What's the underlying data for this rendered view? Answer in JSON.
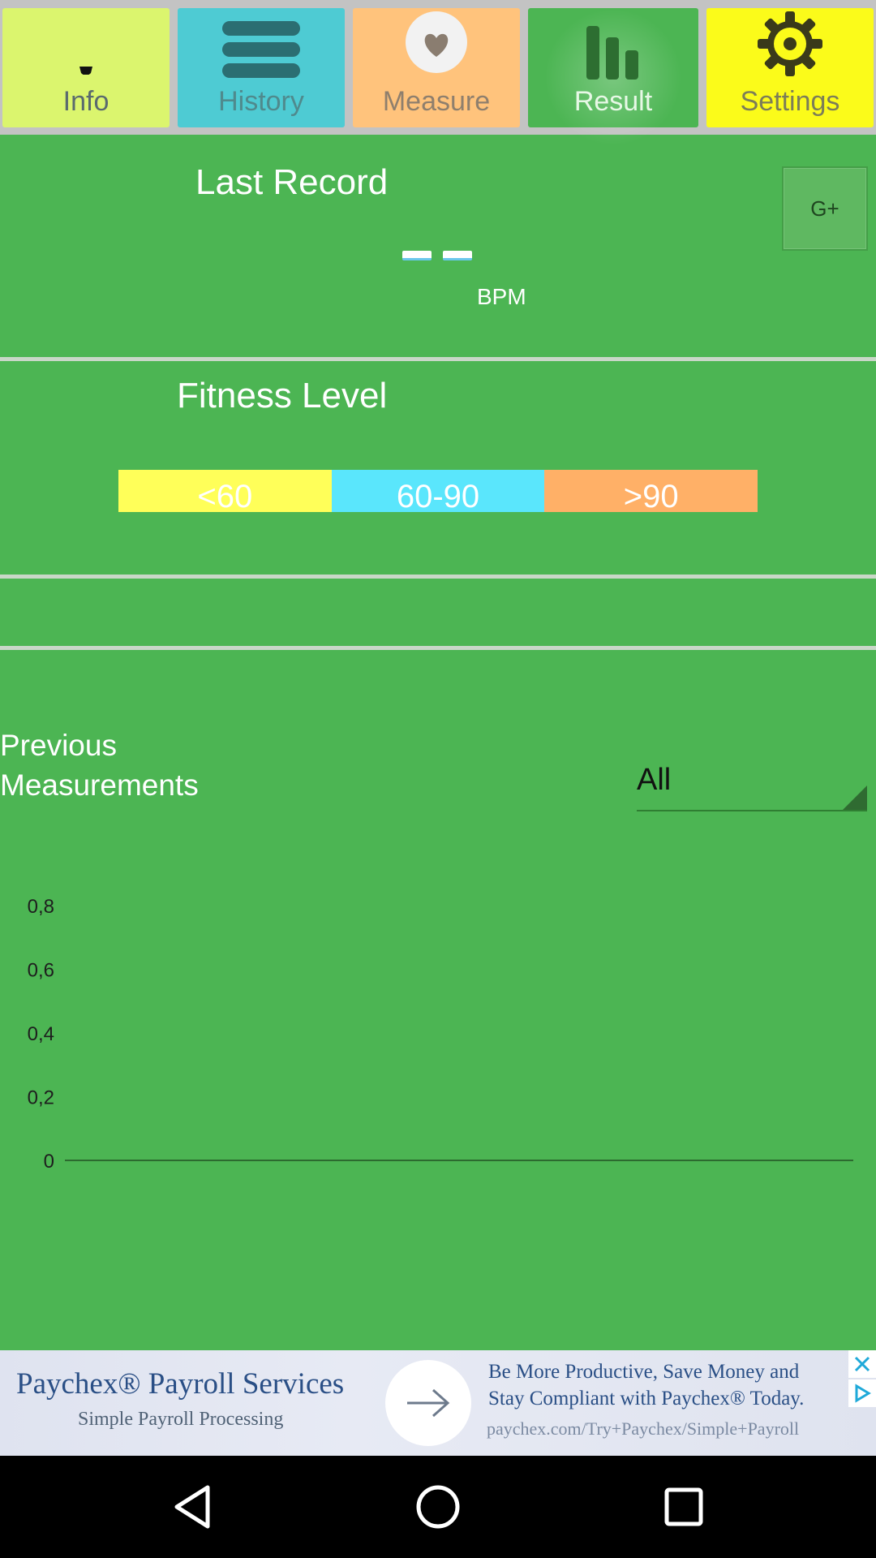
{
  "tabs": {
    "info": {
      "label": "Info",
      "icon": "shield-icon"
    },
    "history": {
      "label": "History",
      "icon": "list-icon"
    },
    "measure": {
      "label": "Measure",
      "icon": "heart-icon"
    },
    "result": {
      "label": "Result",
      "icon": "bar-chart-icon"
    },
    "settings": {
      "label": "Settings",
      "icon": "gear-icon"
    }
  },
  "last_record": {
    "title": "Last Record",
    "value": "--",
    "unit": "BPM",
    "share_label": "G+"
  },
  "fitness": {
    "title": "Fitness Level",
    "ranges": [
      "<60",
      "60-90",
      ">90"
    ]
  },
  "previous": {
    "title_line1": "Previous",
    "title_line2": "Measurements",
    "filter_value": "All"
  },
  "chart_data": {
    "type": "line",
    "title": "",
    "xlabel": "",
    "ylabel": "",
    "y_ticks": [
      "0",
      "0,2",
      "0,4",
      "0,6",
      "0,8"
    ],
    "ylim": [
      0,
      0.8
    ],
    "series": [],
    "grid": false
  },
  "ad": {
    "title": "Paychex® Payroll Services",
    "subtitle": "Simple Payroll Processing",
    "body_line1": "Be More Productive, Save Money and",
    "body_line2": "Stay Compliant with Paychex® Today.",
    "url": "paychex.com/Try+Paychex/Simple+Payroll"
  },
  "colors": {
    "background": "#4cb553",
    "info_tab": "#dbf56e",
    "history_tab": "#4ecbd3",
    "measure_tab": "#ffc37c",
    "result_tab": "#4cb553",
    "settings_tab": "#fbfb1a",
    "fitness_low": "#ffff59",
    "fitness_mid": "#5ae6fc",
    "fitness_high": "#ffb067"
  }
}
